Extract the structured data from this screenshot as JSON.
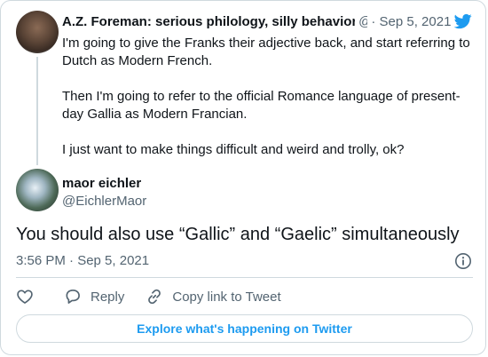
{
  "quoted_tweet": {
    "author_name": "A.Z. Foreman: serious philology, silly behavior",
    "author_handle": "@",
    "separator": "·",
    "date": "Sep 5, 2021",
    "paragraphs": [
      "I'm going to give the Franks their adjective back, and start referring to Dutch as Modern French.",
      "Then I'm going to refer to the official Romance language of present-day Gallia as Modern Francian.",
      "I just want to make things difficult and weird and trolly, ok?"
    ]
  },
  "tweet": {
    "author_name": "maor eichler",
    "author_handle": "@EichlerMaor",
    "text": "You should also use “Gallic” and “Gaelic” simultaneously",
    "time": "3:56 PM · Sep 5, 2021"
  },
  "actions": {
    "like_label": "",
    "reply_label": "Reply",
    "copy_label": "Copy link to Tweet"
  },
  "explore_label": "Explore what's happening on Twitter",
  "colors": {
    "accent": "#1d9bf0",
    "secondary_text": "#536471",
    "border": "#cfd9de"
  },
  "icons": [
    "twitter-bird-icon",
    "info-icon",
    "heart-icon",
    "reply-icon",
    "link-icon"
  ]
}
